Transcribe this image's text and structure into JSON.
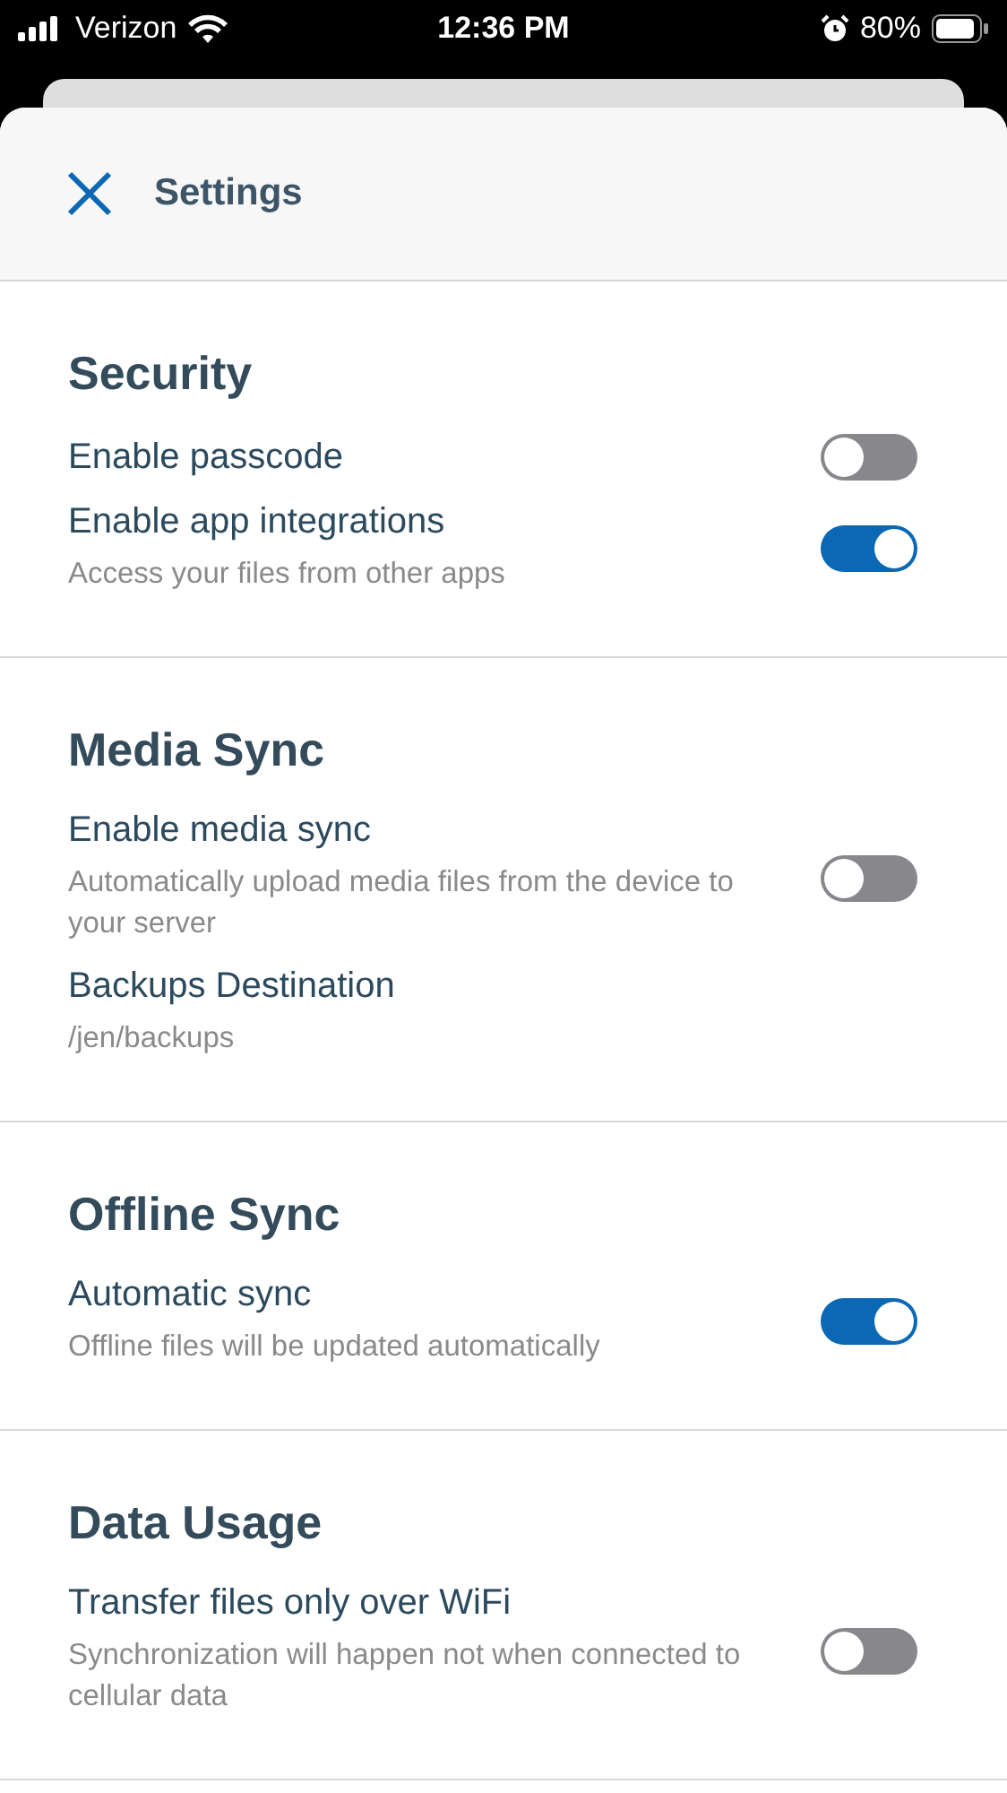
{
  "status_bar": {
    "carrier": "Verizon",
    "time": "12:36 PM",
    "battery": "80%"
  },
  "header": {
    "title": "Settings"
  },
  "sections": [
    {
      "title": "Security",
      "items": [
        {
          "kind": "toggle",
          "title": "Enable passcode",
          "on": false
        },
        {
          "kind": "toggle",
          "title": "Enable app integrations",
          "subtitle": "Access your files from other apps",
          "on": true
        }
      ]
    },
    {
      "title": "Media Sync",
      "items": [
        {
          "kind": "toggle",
          "title": "Enable media sync",
          "subtitle": "Automatically upload media files from the device to your server",
          "on": false
        },
        {
          "kind": "value",
          "title": "Backups Destination",
          "subtitle": "/jen/backups"
        }
      ]
    },
    {
      "title": "Offline Sync",
      "items": [
        {
          "kind": "toggle",
          "title": "Automatic sync",
          "subtitle": "Offline files will be updated automatically",
          "on": true
        }
      ]
    },
    {
      "title": "Data Usage",
      "items": [
        {
          "kind": "toggle",
          "title": "Transfer files only over WiFi",
          "subtitle": "Synchronization will happen not when connected to cellular data",
          "on": false
        }
      ]
    }
  ]
}
